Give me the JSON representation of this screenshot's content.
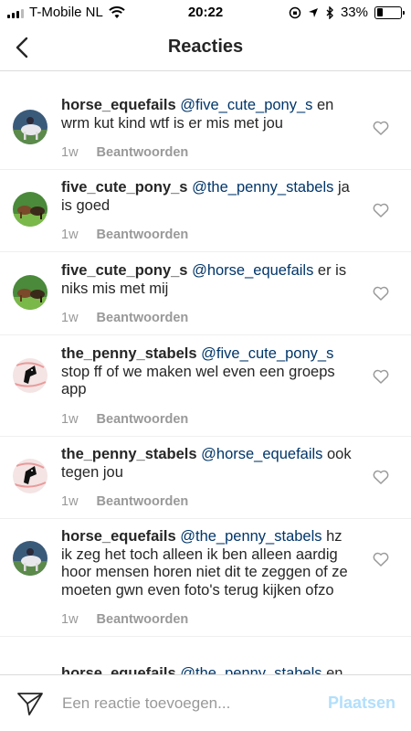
{
  "status_bar": {
    "carrier": "T-Mobile NL",
    "time": "20:22",
    "battery": "33%",
    "battery_level": 0.33
  },
  "header": {
    "title": "Reacties"
  },
  "comments": [
    {
      "user": "horse_equefails",
      "mention": "@five_cute_pony_s",
      "text": " en wrm kut kind wtf is er mis met jou",
      "time": "1w",
      "reply": "Beantwoorden",
      "avatar": "horse-rider-avatar"
    },
    {
      "user": "five_cute_pony_s",
      "mention": "@the_penny_stabels",
      "text": " ja is goed",
      "time": "1w",
      "reply": "Beantwoorden",
      "avatar": "ponies-avatar"
    },
    {
      "user": "five_cute_pony_s",
      "mention": "@horse_equefails",
      "text": " er is niks mis met mij",
      "time": "1w",
      "reply": "Beantwoorden",
      "avatar": "ponies-avatar"
    },
    {
      "user": "the_penny_stabels",
      "mention": "@five_cute_pony_s",
      "text": " stop ff of we maken wel even een groeps app",
      "time": "1w",
      "reply": "Beantwoorden",
      "avatar": "horse-head-avatar"
    },
    {
      "user": "the_penny_stabels",
      "mention": "@horse_equefails",
      "text": " ook tegen jou",
      "time": "1w",
      "reply": "Beantwoorden",
      "avatar": "horse-head-avatar"
    },
    {
      "user": "horse_equefails",
      "mention": "@the_penny_stabels",
      "text": " hz ik zeg het toch alleen ik ben alleen aardig hoor mensen horen niet dit te zeggen of ze moeten gwn even foto's terug kijken ofzo",
      "time": "1w",
      "reply": "Beantwoorden",
      "avatar": "horse-rider-avatar"
    },
    {
      "user": "horse_equefails",
      "mention": "@the_penny_stabels",
      "text": " en",
      "time": "",
      "reply": "",
      "avatar": "horse-rider-avatar"
    }
  ],
  "input": {
    "placeholder": "Een reactie toevoegen...",
    "post_label": "Plaatsen"
  },
  "colors": {
    "mention": "#003569",
    "post_disabled": "#b2dffc",
    "meta": "#999999"
  }
}
